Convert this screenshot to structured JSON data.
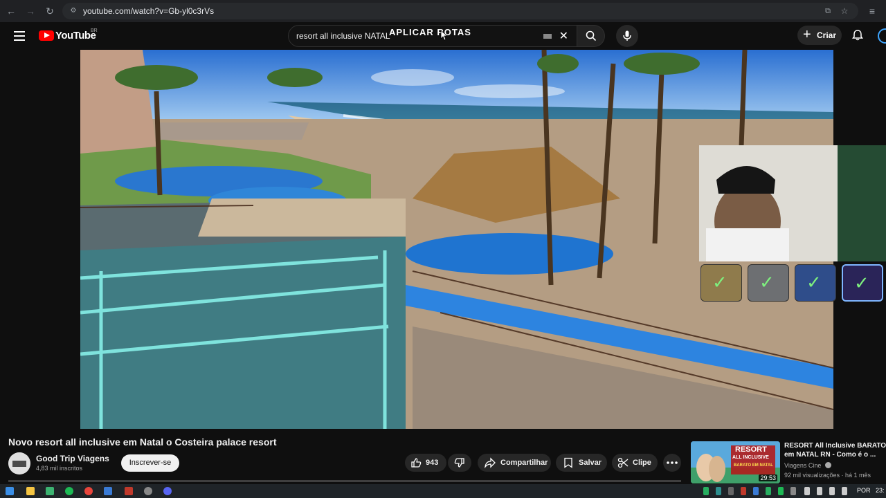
{
  "browser": {
    "url": "youtube.com/watch?v=Gb-yl0c3rVs"
  },
  "header": {
    "logo_text": "YouTube",
    "country_code": "BR",
    "search_value": "resort all inclusive NATAL",
    "overlay_title": "APLICAR ROTAS",
    "create_label": "Criar",
    "icons": [
      "menu-icon",
      "youtube-logo",
      "keyboard-icon",
      "clear-icon",
      "search-icon",
      "mic-icon",
      "plus-icon",
      "bell-icon",
      "avatar"
    ]
  },
  "video": {
    "title": "Novo resort all inclusive em Natal o Costeira palace resort",
    "channel_name": "Good Trip Viagens",
    "subscribers": "4,83 mil inscritos",
    "subscribe_label": "Inscrever-se",
    "likes": "943",
    "share_label": "Compartilhar",
    "save_label": "Salvar",
    "clip_label": "Clipe"
  },
  "recommendation": {
    "title": "RESORT All Inclusive BARATO em NATAL RN - Como é o ...",
    "channel": "Viagens Cine",
    "meta": "92 mil visualizações · há 1 mês",
    "duration": "29:53",
    "thumb_text_1": "RESORT",
    "thumb_text_2": "ALL INCLUSIVE",
    "thumb_text_3": "BARATO EM NATAL"
  },
  "taskbar": {
    "lang": "POR",
    "time": "23:"
  },
  "colors": {
    "background": "#0f0f0f",
    "youtube_red": "#ff0000",
    "surface": "#272727",
    "muted_text": "#aaaaaa"
  }
}
